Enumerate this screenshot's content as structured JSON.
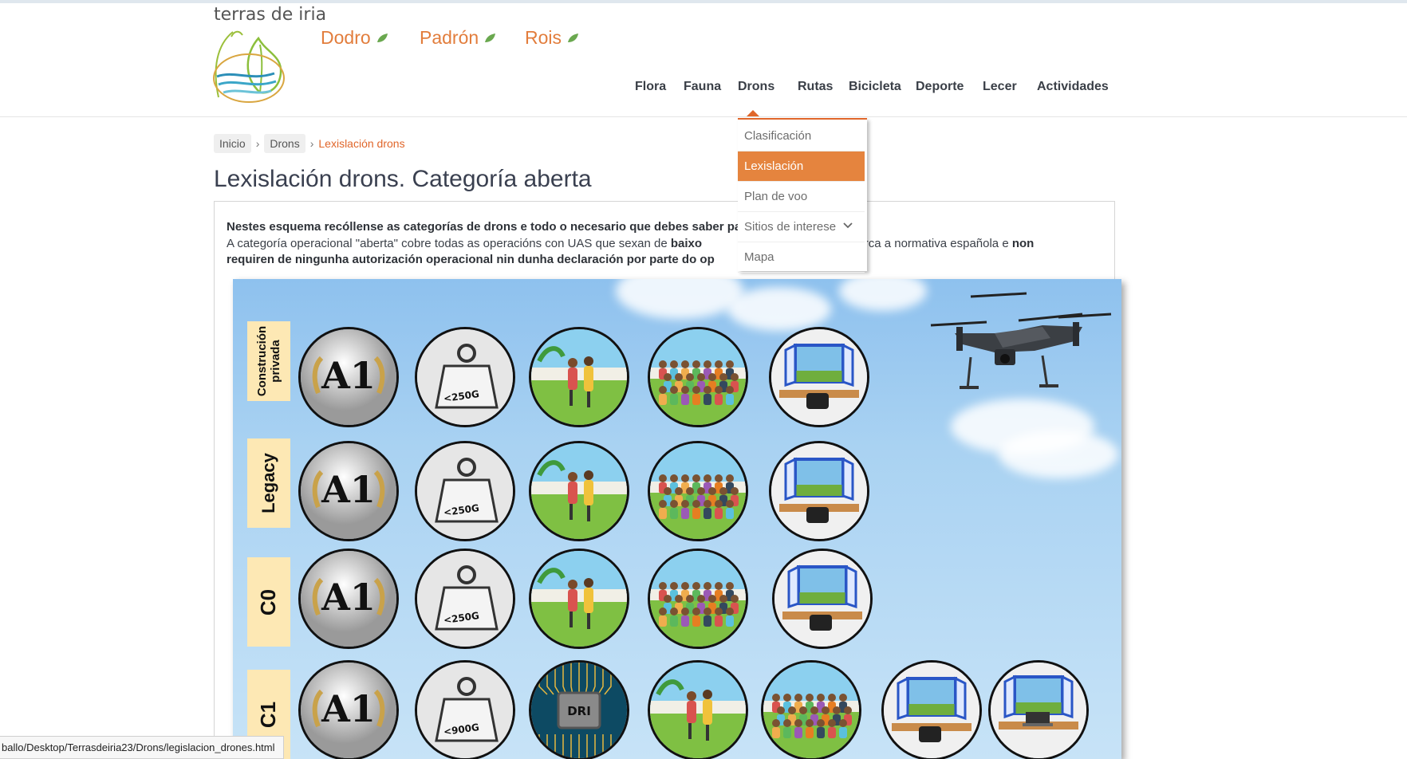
{
  "site": {
    "title": "terras de iria",
    "towns": [
      "Dodro",
      "Padrón",
      "Rois"
    ]
  },
  "nav": {
    "items": [
      "Flora",
      "Fauna",
      "Drons",
      "Rutas",
      "Bicicleta",
      "Deporte",
      "Lecer",
      "Actividades"
    ],
    "active": "Drons"
  },
  "dropdown": {
    "items": [
      "Clasificación",
      "Lexislación",
      "Plan de voo",
      "Sitios de interese",
      "Mapa"
    ],
    "active": "Lexislación"
  },
  "breadcrumb": {
    "home": "Inicio",
    "section": "Drons",
    "current": "Lexislación drons"
  },
  "page": {
    "title": "Lexislación drons. Categoría aberta",
    "line1": "Nestes esquema recóllense as categorías de drons e todo o necesario que debes saber pa",
    "line2_start": "A categoría operacional \"aberta\" cobre todas as operacións con UAS que sexan de ",
    "line2_bold": "baixo",
    "line2_end": "no marca a normativa española e ",
    "line2_bold2": "non",
    "line3_bold": "requiren de ningunha autorización operacional nin dunha declaración por parte do op"
  },
  "infographic": {
    "rows": [
      "Construción privada",
      "Legacy",
      "C0",
      "C1"
    ],
    "a1_label": "A1",
    "weights": [
      "<250G",
      "<250G",
      "<250G",
      "<900G"
    ],
    "dri_label": "DRI"
  },
  "status_url": "ballo/Desktop/Terrasdeiria23/Drons/legislacion_drones.html",
  "colors": {
    "accent": "#e27d3c",
    "active_menu": "#e5843e",
    "label_bg": "#fde8b4"
  }
}
